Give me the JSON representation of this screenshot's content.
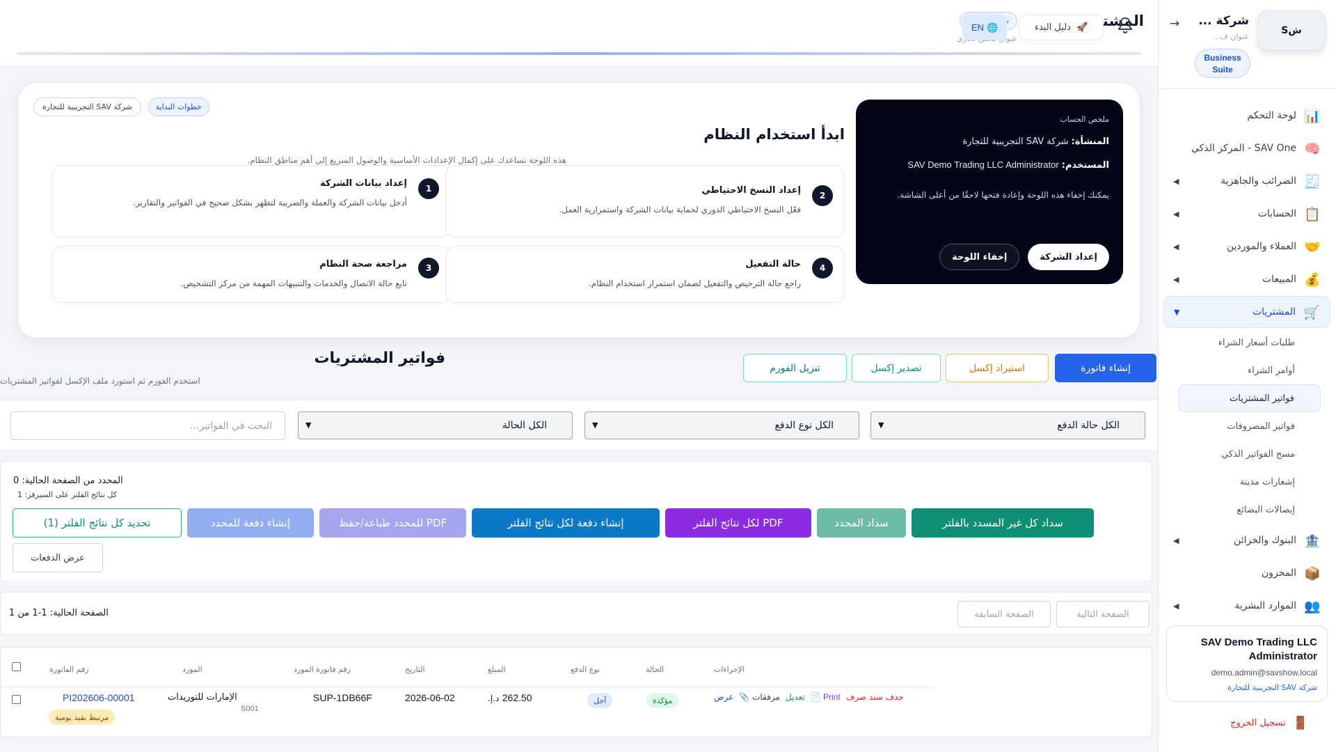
{
  "topbar": {
    "title": "المشتريات",
    "badge": "نظام الأعمال",
    "subtitle": "عنوان فحص تجاري",
    "guide_label": "دليل البدء",
    "guide_icon": "🚀",
    "lang_label": "EN",
    "lang_icon": "🌐"
  },
  "sidebar": {
    "avatar": "شS",
    "company": "شركة ...",
    "company_sub": "عنوان ف...",
    "suite": "Business Suite",
    "collapse_icon": "→",
    "items": [
      {
        "label": "لوحة التحكم",
        "icon": "📊"
      },
      {
        "label": "SAV One - المركز الذكي",
        "icon": "🧠"
      },
      {
        "label": "الضرائب والجاهزية",
        "icon": "🧾"
      },
      {
        "label": "الحسابات",
        "icon": "📋"
      },
      {
        "label": "العملاء والموردين",
        "icon": "🤝"
      },
      {
        "label": "المبيعات",
        "icon": "💰"
      },
      {
        "label": "المشتريات",
        "icon": "🛒"
      },
      {
        "label": "البنوك والخزائن",
        "icon": "🏦"
      },
      {
        "label": "المخزون",
        "icon": "📦"
      },
      {
        "label": "الموارد البشرية",
        "icon": "👥"
      }
    ],
    "subitems": [
      "طلبات أسعار الشراء",
      "أوامر الشراء",
      "فواتير المشتريات",
      "فواتير المصروفات",
      "مسح الفواتير الذكي",
      "إشعارات مدينة",
      "إيصالات البضائع"
    ],
    "user": {
      "name": "SAV Demo Trading LLC Administrator",
      "email": "demo.admin@savshow.local",
      "company": "شركة SAV التجريبية للتجارة"
    },
    "logout": "تسجيل الخروج",
    "logout_icon": "🚪"
  },
  "onboarding": {
    "tag_steps": "خطوات البداية",
    "tag_company": "شركة SAV التجريبية للتجارة",
    "title": "ابدأ استخدام النظام",
    "desc": "هذه اللوحة تساعدك على إكمال الإعدادات الأساسية والوصول السريع إلى أهم مناطق النظام.",
    "account": {
      "label": "ملخص الحساب",
      "facility_label": "المنشأة:",
      "facility": "شركة SAV التجريبية للتجارة",
      "user_label": "المستخدم:",
      "user": "SAV Demo Trading LLC Administrator",
      "note": "يمكنك إخفاء هذه اللوحة وإعادة فتحها لاحقًا من أعلى الشاشة.",
      "btn_setup": "إعداد الشركة",
      "btn_hide": "إخفاء اللوحة"
    },
    "steps": [
      {
        "num": "1",
        "title": "إعداد بيانات الشركة",
        "desc": "أدخل بيانات الشركة والعملة والضريبة لتظهر بشكل صحيح في الفواتير والتقارير."
      },
      {
        "num": "2",
        "title": "إعداد النسخ الاحتياطي",
        "desc": "فعّل النسخ الاحتياطي الدوري لحماية بيانات الشركة واستمرارية العمل."
      },
      {
        "num": "3",
        "title": "مراجعة صحة النظام",
        "desc": "تابع حالة الاتصال والخدمات والتنبيهات المهمة من مركز التشخيص."
      },
      {
        "num": "4",
        "title": "حالة التفعيل",
        "desc": "راجع حالة الترخيص والتفعيل لضمان استمرار استخدام النظام."
      }
    ]
  },
  "section": {
    "title": "فواتير المشتريات",
    "subtitle": "استخدم الفورم ثم استورد ملف الإكسل لفواتير المشتريات.",
    "btn_create": "إنشاء فاتورة",
    "btn_import": "استيراد إكسل",
    "btn_export": "تصدير إكسل",
    "btn_template": "تنزيل الفورم"
  },
  "filters": {
    "payment_status": "الكل حالة الدفع",
    "payment_type": "الكل نوع الدفع",
    "status": "الكل الحالة",
    "search_placeholder": "البحث في الفواتير..."
  },
  "bulk": {
    "selected_count": "المحدد من الصفحة الحالية: 0",
    "server_count": "كل نتائج الفلتر على السيرفر: 1",
    "btn_pay_all_unpaid": "سداد كل غير المسدد بالفلتر",
    "btn_pay_selected": "سداد المحدد",
    "btn_pdf_all": "PDF لكل نتائج الفلتر",
    "btn_batch_all": "إنشاء دفعة لكل نتائج الفلتر",
    "btn_pdf_selected": "PDF للمحدد طباعة/حفظ",
    "btn_batch_selected": "إنشاء دفعة للمحدد",
    "btn_select_all": "تحديد كل نتائج الفلتر (1)",
    "btn_view_payments": "عرض الدفعات"
  },
  "pagination": {
    "info": "الصفحة الحالية: 1-1 من 1",
    "next": "الصفحة التالية",
    "prev": "الصفحة السابقة"
  },
  "table": {
    "headers": {
      "invoice_no": "رقم الفاتورة",
      "supplier": "المورد",
      "supplier_invoice": "رقم فاتورة المورد",
      "date": "التاريخ",
      "amount": "المبلغ",
      "payment_type": "نوع الدفع",
      "status": "الحالة",
      "actions": "الإجراءات"
    },
    "rows": [
      {
        "invoice_no": "PI202606-00001",
        "journal_badge": "مرتبط بقيد يومية",
        "supplier": "الإمارات للتوريدات",
        "supplier_code": "S001",
        "supplier_invoice": "SUP-1DB66F",
        "date": "2026-06-02",
        "amount": "262.50",
        "currency": "د.إ.",
        "payment_type": "آجل",
        "status": "مؤكدة",
        "act_view": "عرض",
        "act_attach": "مرفقات",
        "act_edit": "تعديل",
        "act_print": "Print",
        "act_delete": "حذف سند صرف"
      }
    ]
  },
  "colors": {
    "primary": "#2563eb",
    "dark_panel": "#020617",
    "teal": "#0f8f73",
    "purple": "#8b2be2"
  },
  "icons": {
    "bell": "bell-icon"
  }
}
